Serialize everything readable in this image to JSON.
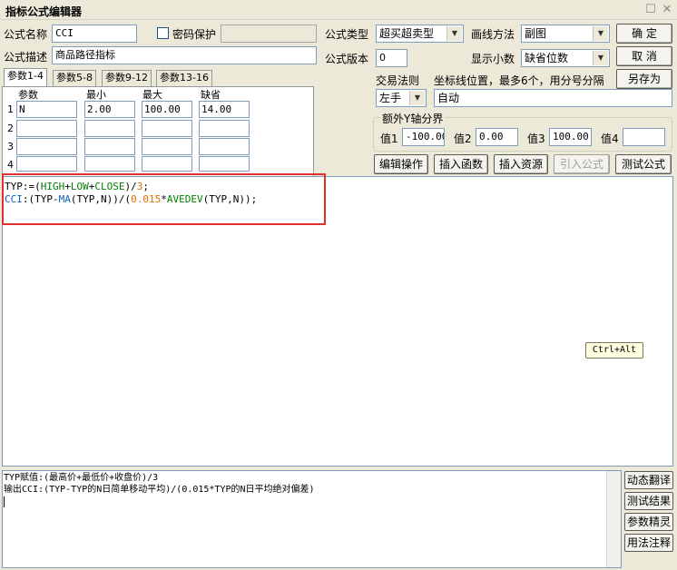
{
  "window": {
    "title": "指标公式编辑器"
  },
  "form": {
    "name_label": "公式名称",
    "name_value": "CCI",
    "password_label": "密码保护",
    "desc_label": "公式描述",
    "desc_value": "商品路径指标",
    "type_label": "公式类型",
    "type_value": "超买超卖型",
    "draw_label": "画线方法",
    "draw_value": "副图",
    "version_label": "公式版本",
    "version_value": "0",
    "decimals_label": "显示小数",
    "decimals_value": "缺省位数"
  },
  "buttons": {
    "ok": "确  定",
    "cancel": "取  消",
    "save_as": "另存为",
    "edit_ops": "编辑操作",
    "insert_func": "插入函数",
    "insert_res": "插入资源",
    "import_formula": "引入公式",
    "test_formula": "测试公式"
  },
  "tabs": [
    "参数1-4",
    "参数5-8",
    "参数9-12",
    "参数13-16"
  ],
  "params": {
    "headers": [
      "参数",
      "最小",
      "最大",
      "缺省"
    ],
    "rows": [
      {
        "num": "1",
        "name": "N",
        "min": "2.00",
        "max": "100.00",
        "default": "14.00"
      },
      {
        "num": "2",
        "name": "",
        "min": "",
        "max": "",
        "default": ""
      },
      {
        "num": "3",
        "name": "",
        "min": "",
        "max": "",
        "default": ""
      },
      {
        "num": "4",
        "name": "",
        "min": "",
        "max": "",
        "default": ""
      }
    ]
  },
  "trading": {
    "rule_label": "交易法则",
    "coord_label": "坐标线位置，最多6个，用分号分隔",
    "rule_value": "左手",
    "coord_value": "自动"
  },
  "yaxis": {
    "group_label": "额外Y轴分界",
    "v1_label": "值1",
    "v1": "-100.00",
    "v2_label": "值2",
    "v2": "0.00",
    "v3_label": "值3",
    "v3": "100.00",
    "v4_label": "值4",
    "v4": ""
  },
  "code": {
    "line1": [
      {
        "t": "TYP:=(",
        "c": "#000000"
      },
      {
        "t": "HIGH",
        "c": "#008000"
      },
      {
        "t": "+",
        "c": "#000000"
      },
      {
        "t": "LOW",
        "c": "#008000"
      },
      {
        "t": "+",
        "c": "#000000"
      },
      {
        "t": "CLOSE",
        "c": "#008000"
      },
      {
        "t": ")/",
        "c": "#000000"
      },
      {
        "t": "3",
        "c": "#e07000"
      },
      {
        "t": ";",
        "c": "#000000"
      }
    ],
    "line2": [
      {
        "t": "CCI",
        "c": "#1060c0"
      },
      {
        "t": ":(TYP-",
        "c": "#000000"
      },
      {
        "t": "MA",
        "c": "#1060c0"
      },
      {
        "t": "(TYP,N))/(",
        "c": "#000000"
      },
      {
        "t": "0.015",
        "c": "#e07000"
      },
      {
        "t": "*",
        "c": "#000000"
      },
      {
        "t": "AVEDEV",
        "c": "#008000"
      },
      {
        "t": "(TYP,N));",
        "c": "#000000"
      }
    ]
  },
  "tooltip": "Ctrl+Alt",
  "output": {
    "line1": "TYP赋值:(最高价+最低价+收盘价)/3",
    "line2": "输出CCI:(TYP-TYP的N日简单移动平均)/(0.015*TYP的N日平均绝对偏差)"
  },
  "side_buttons": [
    "动态翻译",
    "测试结果",
    "参数精灵",
    "用法注释"
  ],
  "colors": {
    "highlight_box": "#e03030",
    "keyword_green": "#008000",
    "keyword_blue": "#1060c0",
    "number_orange": "#e07000"
  }
}
